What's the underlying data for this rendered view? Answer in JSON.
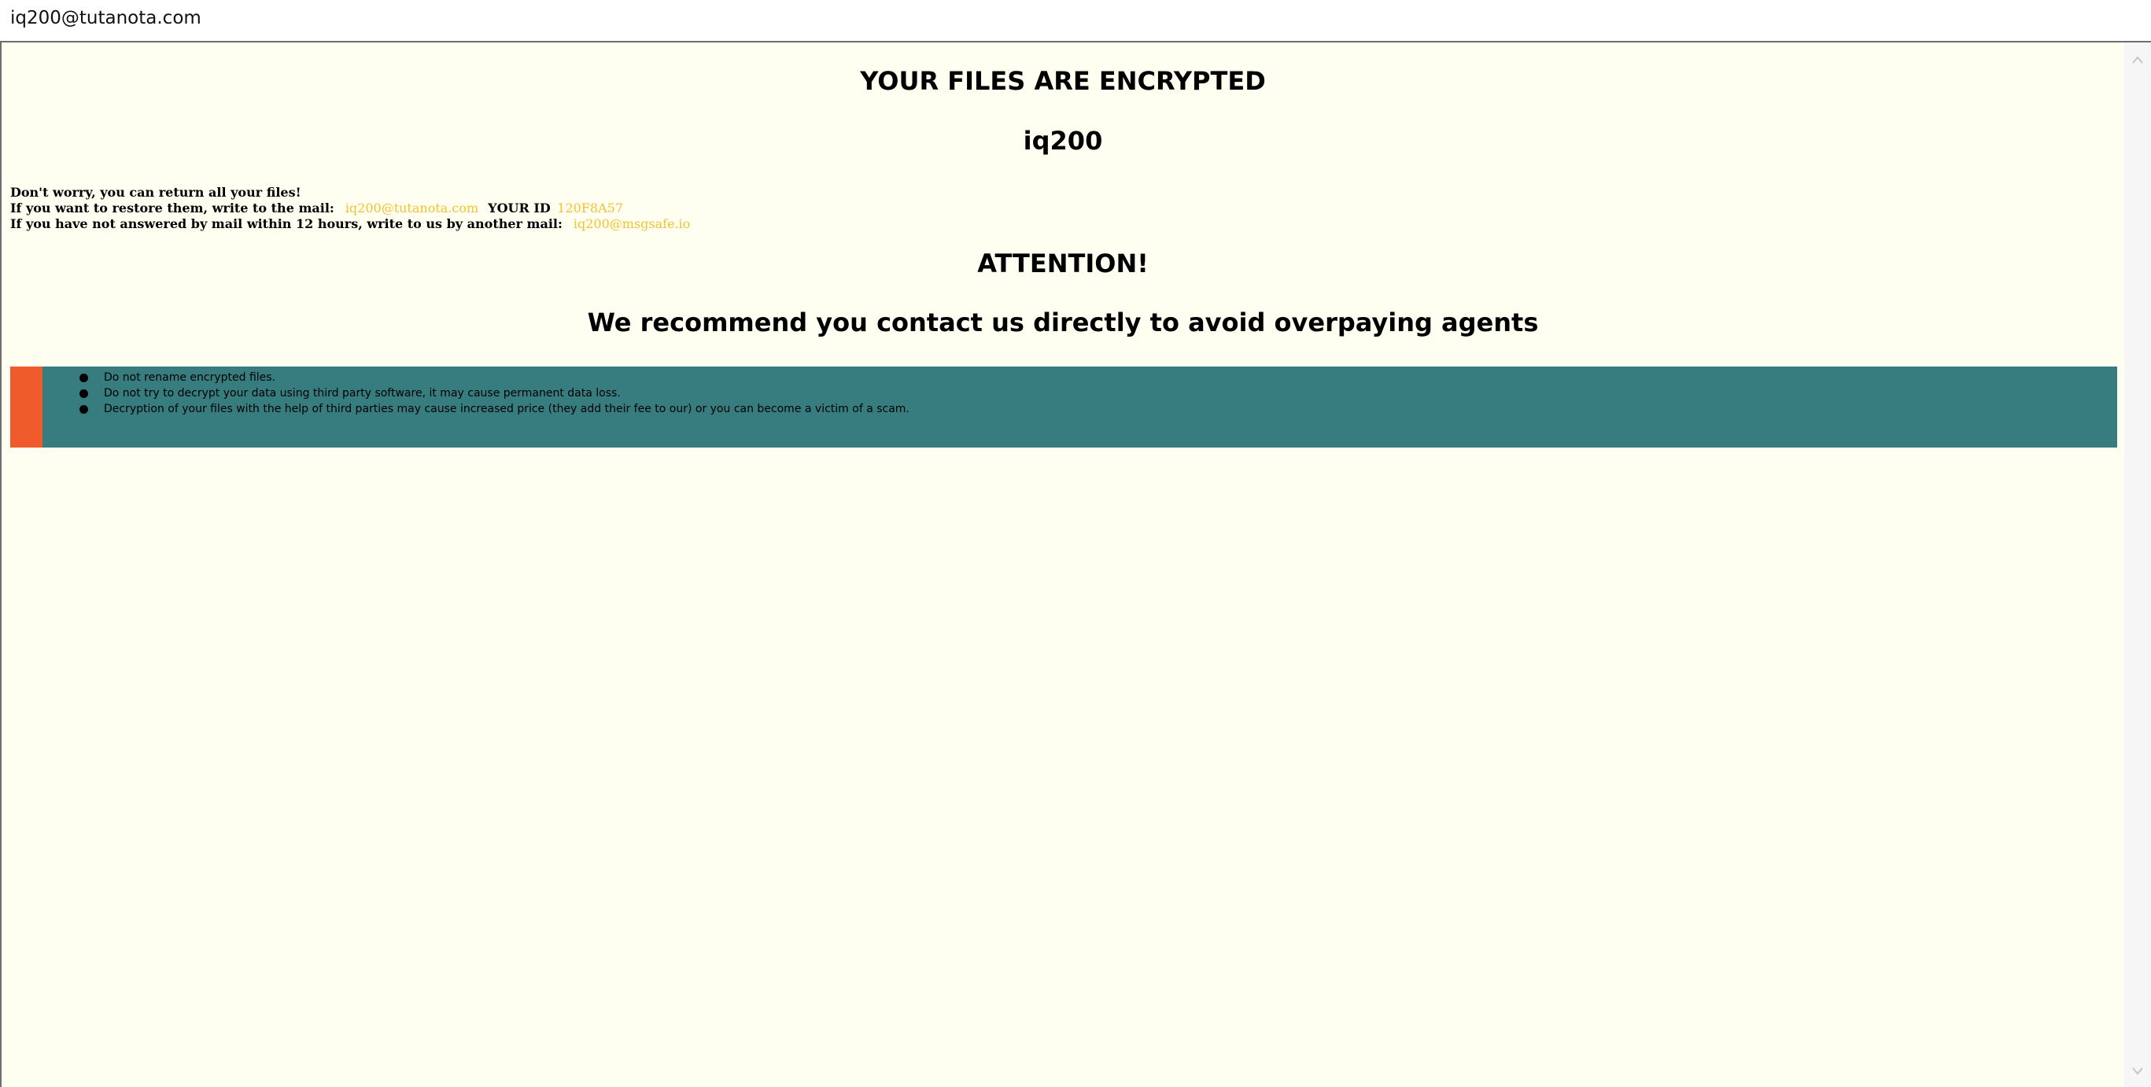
{
  "window": {
    "title": "iq200@tutanota.com"
  },
  "note": {
    "heading": "YOUR FILES ARE ENCRYPTED",
    "name": "iq200",
    "line1": "Don't worry, you can return all your files!",
    "line2_prefix": "If you want to restore them, write to the mail:",
    "primary_email": "iq200@tutanota.com",
    "id_label": "YOUR ID",
    "id_value": "120F8A57",
    "line3_prefix": "If you have not answered by mail within 12 hours, write to us by another mail:",
    "secondary_email": "iq200@msgsafe.io",
    "attention": "ATTENTION!",
    "recommendation": "We recommend you contact us directly to avoid overpaying agents",
    "warnings": [
      "Do not rename encrypted files.",
      "Do not try to decrypt your data using third party software, it may cause permanent data loss.",
      "Decryption of your files with the help of third parties may cause increased price (they add their fee to our) or you can become a victim of a scam."
    ]
  },
  "colors": {
    "page_background": "#fefff0",
    "email_highlight": "#f2c230",
    "warning_box": "#377d7f",
    "warning_stripe": "#ef5b2a"
  },
  "icons": {
    "scroll_up": "chevron-up-icon",
    "scroll_down": "chevron-down-icon"
  }
}
